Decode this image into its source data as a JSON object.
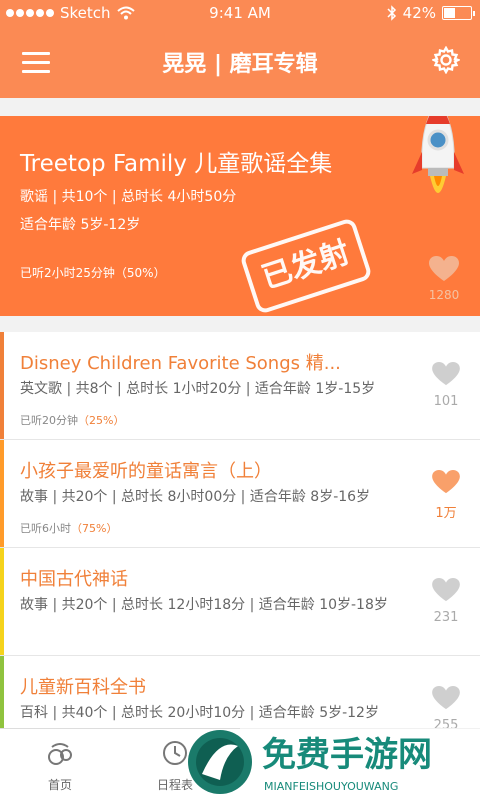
{
  "status": {
    "carrier": "Sketch",
    "time": "9:41 AM",
    "battery": "42%",
    "battery_level": 0.42
  },
  "nav": {
    "title": "晃晃 | 磨耳专辑"
  },
  "featured": {
    "title": "Treetop Family 儿童歌谣全集",
    "meta1": "歌谣 | 共10个 | 总时长 4小时50分",
    "meta2": "适合年龄 5岁-12岁",
    "progress": "已听2小时25分钟（50%）",
    "stamp": "已发射",
    "likes": "1280"
  },
  "albums": [
    {
      "title": "Disney Children Favorite Songs 精...",
      "meta": "英文歌 | 共8个 | 总时长 1小时20分 | 适合年龄 1岁-15岁",
      "progress": "已听20分钟",
      "percent": "（25%）",
      "likes": "101",
      "liked": false,
      "accent": "#f08039"
    },
    {
      "title": "小孩子最爱听的童话寓言（上）",
      "meta": "故事 | 共20个 | 总时长 8小时00分 | 适合年龄 8岁-16岁",
      "progress": "已听6小时",
      "percent": "（75%）",
      "likes": "1万",
      "liked": true,
      "accent": "#ff9b2a"
    },
    {
      "title": "中国古代神话",
      "meta": "故事 | 共20个 | 总时长 12小时18分 | 适合年龄 10岁-18岁",
      "progress": "",
      "percent": "",
      "likes": "231",
      "liked": false,
      "accent": "#f5d31c"
    },
    {
      "title": "儿童新百科全书",
      "meta": "百科 | 共40个 | 总时长 20小时10分 | 适合年龄 5岁-12岁",
      "progress": "",
      "percent": "",
      "likes": "255",
      "liked": false,
      "accent": "#8fc33e"
    }
  ],
  "tabs": [
    {
      "label": "首页",
      "icon": "home-icon"
    },
    {
      "label": "日程表",
      "icon": "clock-icon"
    }
  ],
  "watermark": {
    "text": "免费手游网",
    "sub": "MIANFEISHOUYOUWANG"
  },
  "colors": {
    "primary": "#fb8a54",
    "featured_bg": "#ff7a3c",
    "accent_text": "#f08039"
  }
}
